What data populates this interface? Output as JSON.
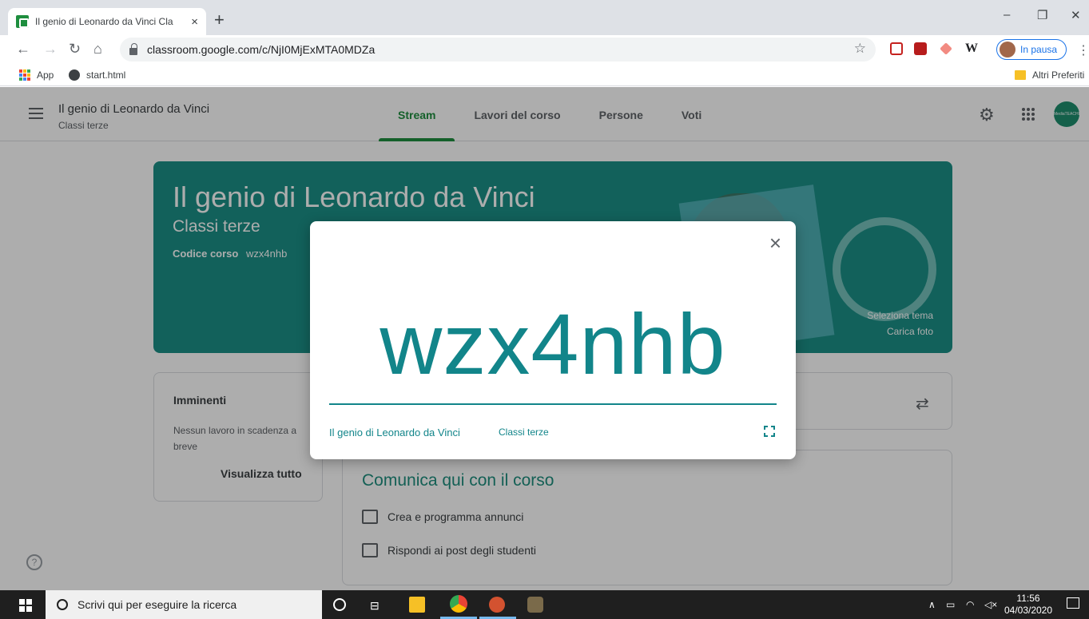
{
  "browser": {
    "tab_title": "Il genio di Leonardo da Vinci Cla",
    "tab_close": "×",
    "new_tab": "+",
    "url": "classroom.google.com/c/NjI0MjExMTA0MDZa",
    "profile_label": "In pausa",
    "bookmarks": {
      "apps": "App",
      "start": "start.html",
      "other": "Altri Preferiti"
    },
    "window_controls": {
      "minimize": "–",
      "maximize": "❐",
      "close": "✕"
    }
  },
  "classroom": {
    "course_name": "Il genio di Leonardo da Vinci",
    "section": "Classi terze",
    "tabs": [
      "Stream",
      "Lavori del corso",
      "Persone",
      "Voti"
    ],
    "active_tab": "Stream",
    "avatar_text": "MediaTEACHER"
  },
  "banner": {
    "title": "Il genio di Leonardo da Vinci",
    "subtitle": "Classi terze",
    "code_label": "Codice corso",
    "code_value": "wzx4nhb",
    "select_theme": "Seleziona tema",
    "upload_photo": "Carica foto"
  },
  "upcoming": {
    "title": "Imminenti",
    "empty_text": "Nessun lavoro in scadenza a breve",
    "view_all": "Visualizza tutto"
  },
  "stream": {
    "communicate_title": "Comunica qui con il corso",
    "items": [
      "Crea e programma annunci",
      "Rispondi ai post degli studenti"
    ]
  },
  "dialog": {
    "code": "wzx4nhb",
    "course_name": "Il genio di Leonardo da Vinci",
    "section": "Classi terze",
    "close": "×"
  },
  "taskbar": {
    "search_placeholder": "Scrivi qui per eseguire la ricerca",
    "time": "11:56",
    "date": "04/03/2020"
  },
  "colors": {
    "teal_accent": "#12858a",
    "banner": "#1b8f86",
    "green_tab": "#1e8e3e",
    "profile_blue": "#1a73e8"
  }
}
